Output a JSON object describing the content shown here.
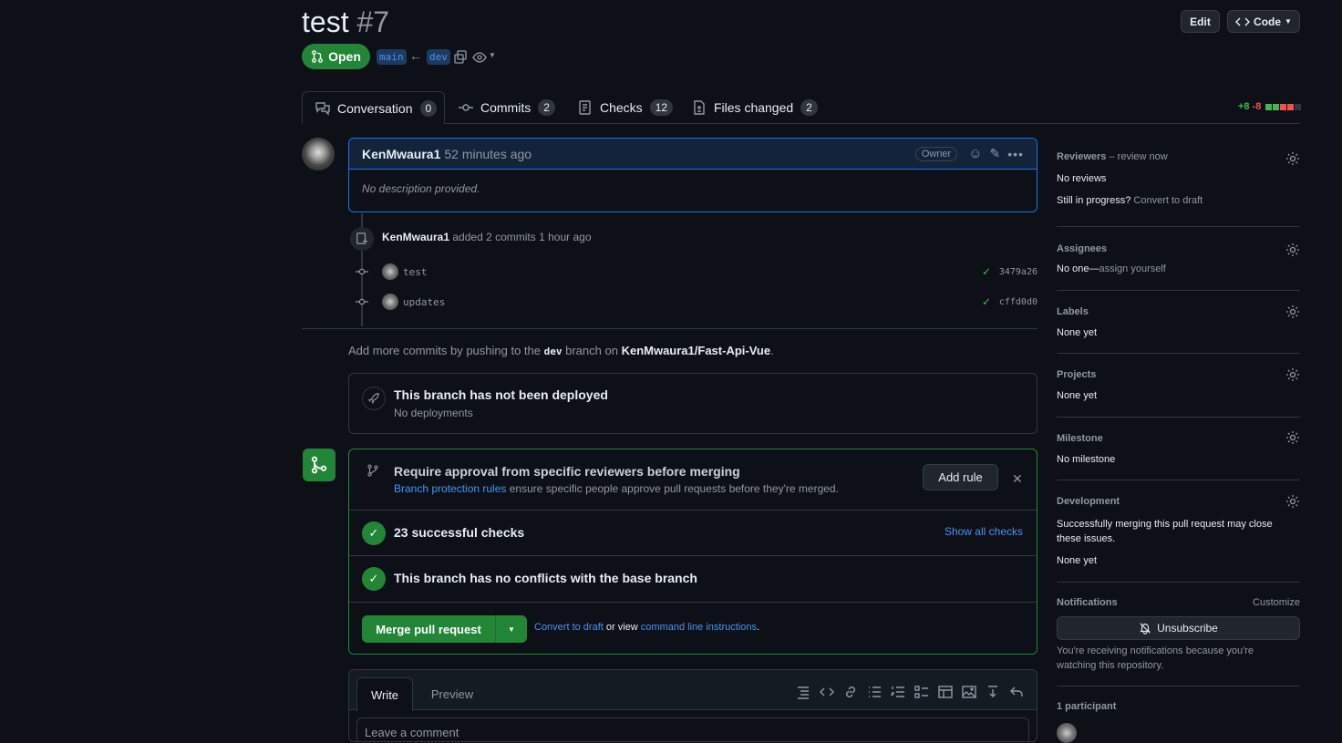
{
  "pr": {
    "title": "test",
    "number": "#7",
    "state": "Open",
    "base_branch": "main",
    "head_branch": "dev"
  },
  "header_buttons": {
    "edit": "Edit",
    "code": "Code"
  },
  "tabs": [
    {
      "label": "Conversation",
      "count": "0"
    },
    {
      "label": "Commits",
      "count": "2"
    },
    {
      "label": "Checks",
      "count": "12"
    },
    {
      "label": "Files changed",
      "count": "2"
    }
  ],
  "diffstat": {
    "additions": "+8",
    "deletions": "-8"
  },
  "comment": {
    "author": "KenMwaura1",
    "time": "52 minutes ago",
    "role": "Owner",
    "body": "No description provided."
  },
  "timeline": {
    "author": "KenMwaura1",
    "action": "added 2 commits",
    "time": "1 hour ago",
    "commits": [
      {
        "message": "test",
        "sha": "3479a26"
      },
      {
        "message": "updates",
        "sha": "cffd0d0"
      }
    ]
  },
  "push_hint": {
    "prefix": "Add more commits by pushing to the",
    "branch": "dev",
    "middle": "branch on",
    "repo": "KenMwaura1/Fast-Api-Vue",
    "suffix": "."
  },
  "deploy": {
    "title": "This branch has not been deployed",
    "subtitle": "No deployments"
  },
  "merge_box": {
    "approval_title": "Require approval from specific reviewers before merging",
    "approval_link": "Branch protection rules",
    "approval_text": "ensure specific people approve pull requests before they're merged.",
    "add_rule": "Add rule",
    "checks_title": "23 successful checks",
    "show_checks": "Show all checks",
    "conflicts_title": "This branch has no conflicts with the base branch",
    "merge_button": "Merge pull request",
    "convert_draft": "Convert to draft",
    "or_view": "or view",
    "cli_link": "command line instructions",
    "cli_suffix": "."
  },
  "editor": {
    "write_tab": "Write",
    "preview_tab": "Preview",
    "placeholder": "Leave a comment"
  },
  "sidebar": {
    "reviewers": {
      "title": "Reviewers",
      "suffix": " – review now",
      "value": "No reviews",
      "progress": "Still in progress?",
      "convert": "Convert to draft"
    },
    "assignees": {
      "title": "Assignees",
      "value_prefix": "No one—",
      "value_link": "assign yourself"
    },
    "labels": {
      "title": "Labels",
      "value": "None yet"
    },
    "projects": {
      "title": "Projects",
      "value": "None yet"
    },
    "milestone": {
      "title": "Milestone",
      "value": "No milestone"
    },
    "development": {
      "title": "Development",
      "desc": "Successfully merging this pull request may close these issues.",
      "value": "None yet"
    },
    "notifications": {
      "title": "Notifications",
      "customize": "Customize",
      "button": "Unsubscribe",
      "note": "You're receiving notifications because you're watching this repository."
    },
    "participants": {
      "title": "1 participant"
    }
  },
  "colors": {
    "bg": "#0d1117",
    "green": "#238636",
    "accent": "#4493f8",
    "border": "#30363d"
  }
}
